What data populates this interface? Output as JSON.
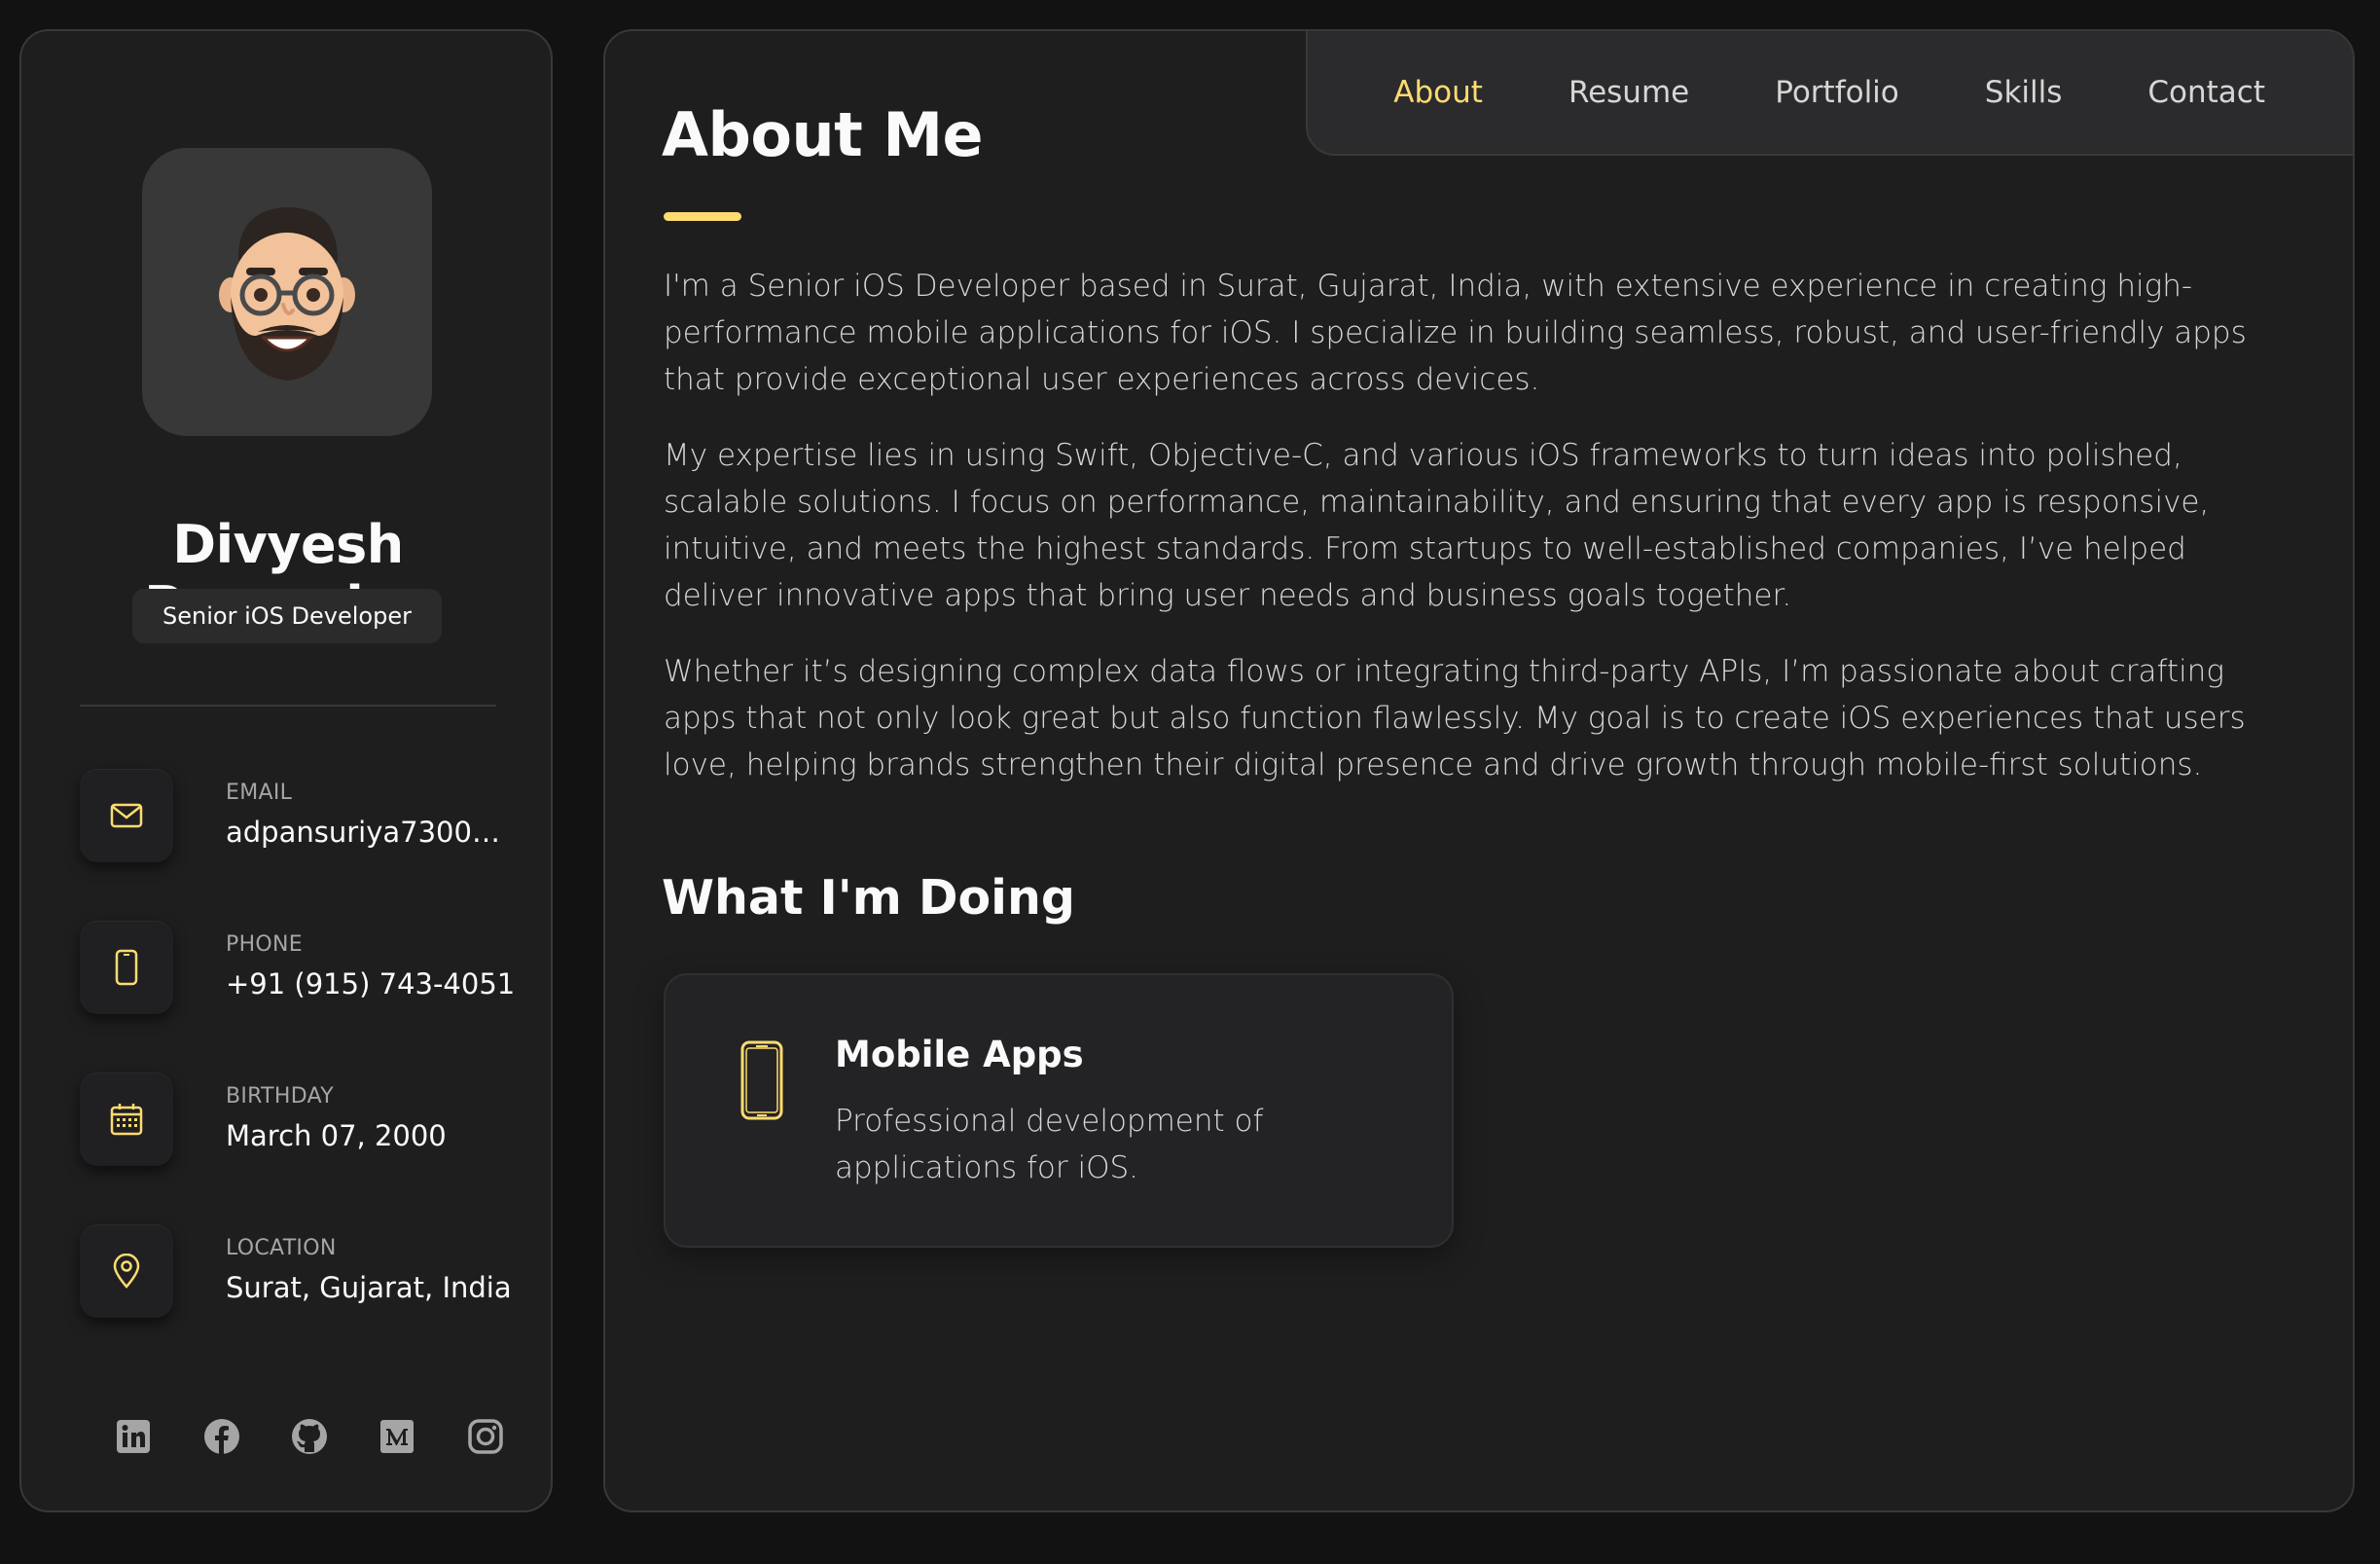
{
  "colors": {
    "accent": "#ffdb70",
    "background": "#121212",
    "card": "#1e1e1f",
    "text": "#fafafa",
    "muted": "#d6d6d6"
  },
  "sidebar": {
    "avatar_icon": "memoji-avatar",
    "name": "Divyesh Pansuriya",
    "title": "Senior iOS Developer",
    "contacts": [
      {
        "label": "EMAIL",
        "value": "adpansuriya7300@...",
        "icon": "mail-icon"
      },
      {
        "label": "PHONE",
        "value": "+91 (915) 743-4051",
        "icon": "phone-icon"
      },
      {
        "label": "BIRTHDAY",
        "value": "March 07, 2000",
        "icon": "calendar-icon"
      },
      {
        "label": "LOCATION",
        "value": "Surat, Gujarat, India",
        "icon": "location-pin-icon"
      }
    ],
    "socials": [
      "linkedin-icon",
      "facebook-icon",
      "github-icon",
      "medium-icon",
      "instagram-icon"
    ]
  },
  "nav": {
    "items": [
      "About",
      "Resume",
      "Portfolio",
      "Skills",
      "Contact"
    ],
    "active": "About"
  },
  "about": {
    "title": "About Me",
    "paragraphs": [
      "I'm a Senior iOS Developer based in Surat, Gujarat, India, with extensive experience in creating high-performance mobile applications for iOS. I specialize in building seamless, robust, and user-friendly apps that provide exceptional user experiences across devices.",
      "My expertise lies in using Swift, Objective-C, and various iOS frameworks to turn ideas into polished, scalable solutions. I focus on performance, maintainability, and ensuring that every app is responsive, intuitive, and meets the highest standards. From startups to well-established companies, I’ve helped deliver innovative apps that bring user needs and business goals together.",
      "Whether it’s designing complex data flows or integrating third-party APIs, I’m passionate about crafting apps that not only look great but also function flawlessly. My goal is to create iOS experiences that users love, helping brands strengthen their digital presence and drive growth through mobile-first solutions."
    ]
  },
  "services": {
    "title": "What I'm Doing",
    "items": [
      {
        "title": "Mobile Apps",
        "description": "Professional development of applications for iOS.",
        "icon": "smartphone-icon"
      }
    ]
  }
}
